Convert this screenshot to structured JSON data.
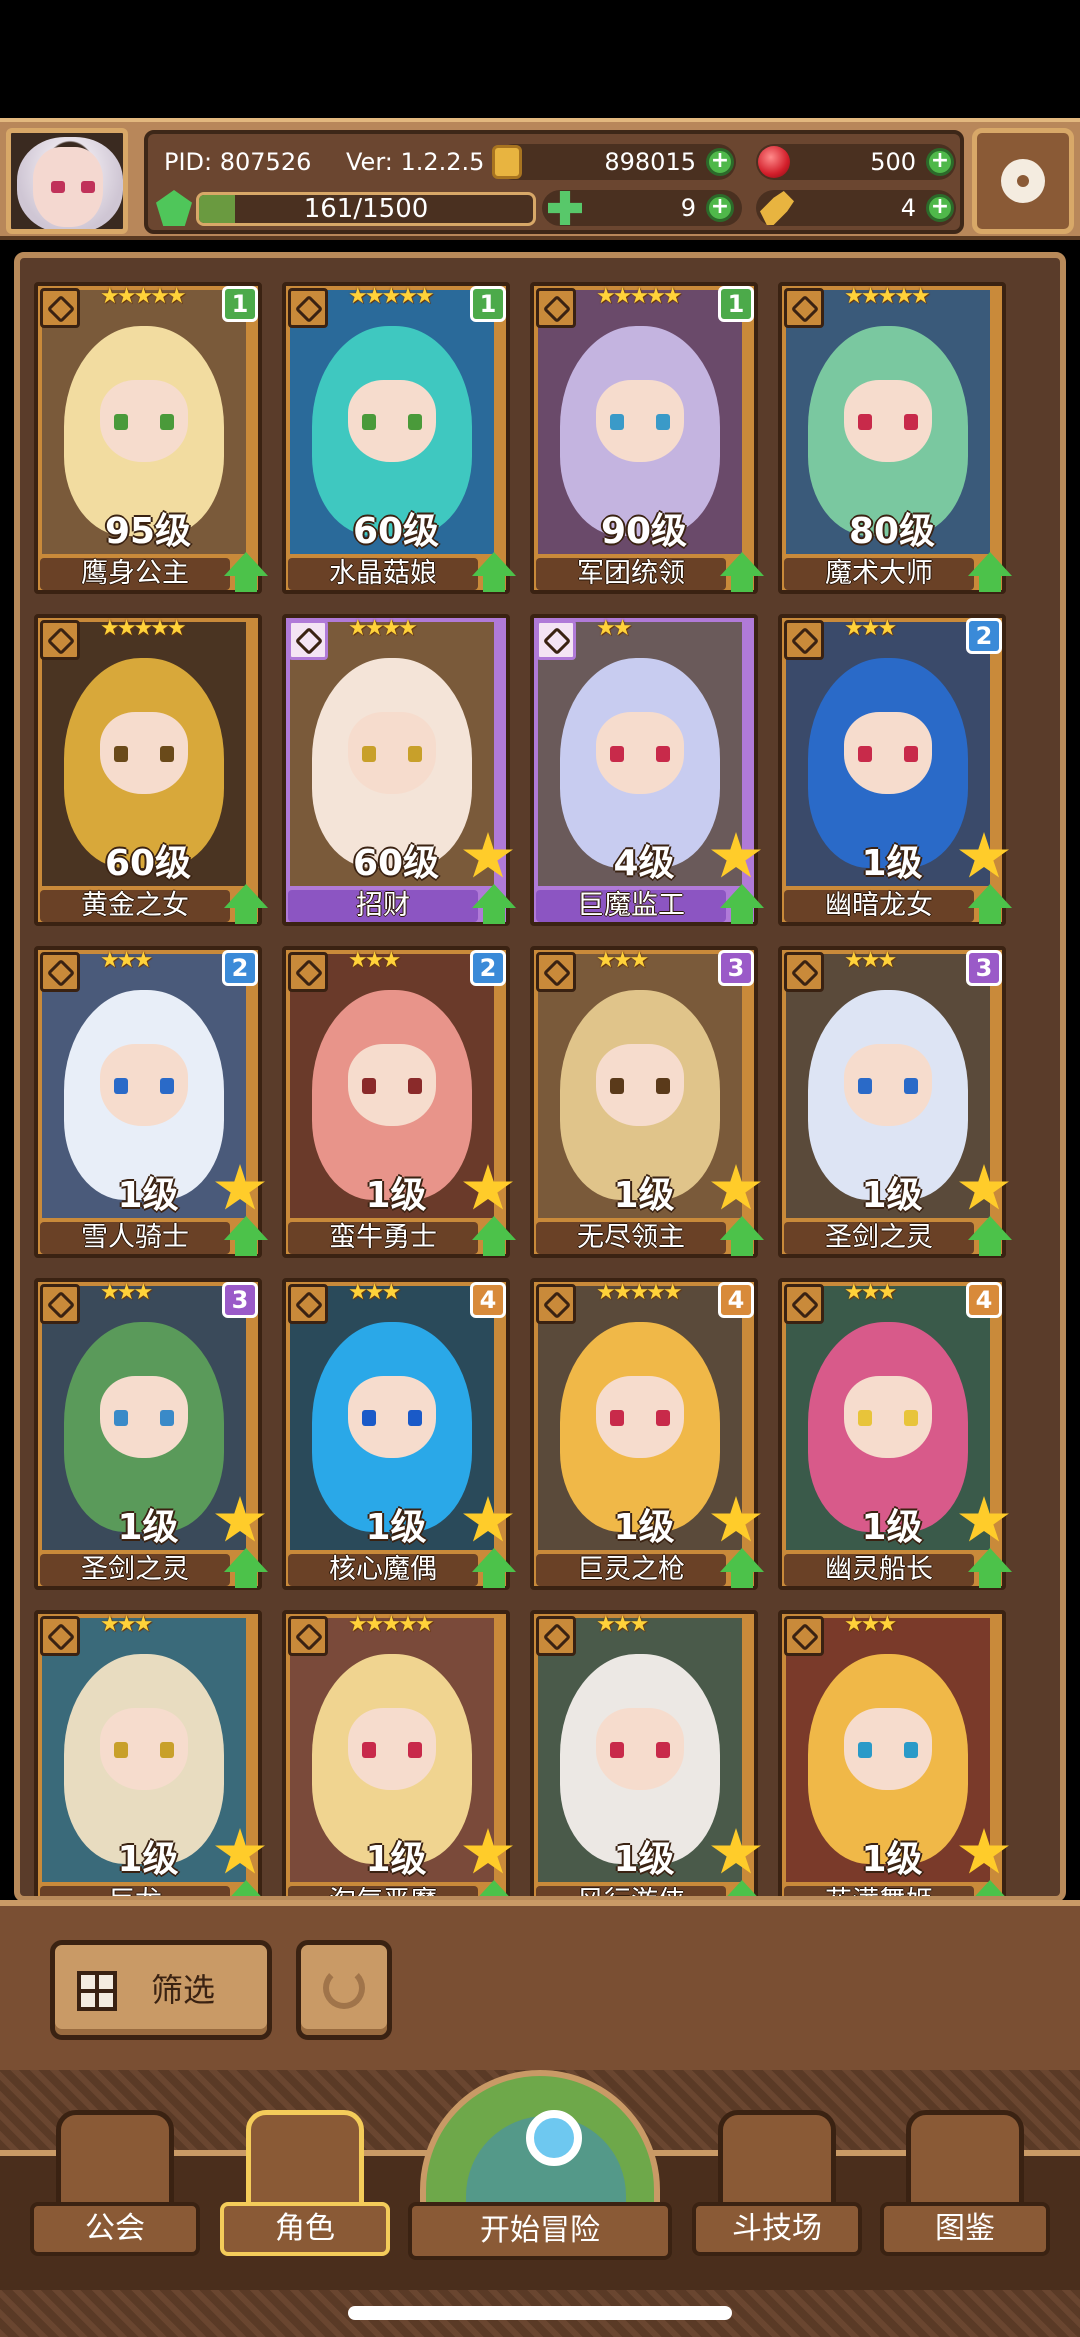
{
  "header": {
    "pid": "PID: 807526",
    "version": "Ver: 1.2.2.5",
    "gold": "898015",
    "ruby": "500",
    "exp": "161/1500",
    "exp_progress": 0.107,
    "clover": "9",
    "key": "4"
  },
  "cards": [
    {
      "name": "鹰身公主",
      "level": "95级",
      "stars": "★★★★★",
      "rank": "1",
      "rank_color": "#4caa4a",
      "frame": "gold",
      "hair": "#f2dca0",
      "bg": "#7a5a3a",
      "eye": "#4a9a3a",
      "big_star": false
    },
    {
      "name": "水晶菇娘",
      "level": "60级",
      "stars": "★★★★★",
      "rank": "1",
      "rank_color": "#4caa4a",
      "frame": "gold",
      "hair": "#3fc8c0",
      "bg": "#2a6a9a",
      "eye": "#4a9a3a",
      "big_star": false
    },
    {
      "name": "军团统领",
      "level": "90级",
      "stars": "★★★★★",
      "rank": "1",
      "rank_color": "#4caa4a",
      "frame": "gold",
      "hair": "#c4b4e0",
      "bg": "#6a4a6a",
      "eye": "#3a9ac8",
      "big_star": false
    },
    {
      "name": "魔术大师",
      "level": "80级",
      "stars": "★★★★★",
      "rank": "",
      "rank_color": "",
      "frame": "gold",
      "hair": "#7ac8a0",
      "bg": "#3a5a7a",
      "eye": "#c82a4a",
      "big_star": false
    },
    {
      "name": "黄金之女",
      "level": "60级",
      "stars": "★★★★★",
      "rank": "",
      "rank_color": "",
      "frame": "gold",
      "hair": "#d8a83a",
      "bg": "#4a3422",
      "eye": "#6a4a1a",
      "big_star": false
    },
    {
      "name": "招财",
      "level": "60级",
      "stars": "★★★★",
      "rank": "",
      "rank_color": "",
      "frame": "purple",
      "hair": "#f4e4d8",
      "bg": "#7a5a3a",
      "eye": "#c8a02a",
      "big_star": true
    },
    {
      "name": "巨魔监工",
      "level": "4级",
      "stars": "★★",
      "rank": "",
      "rank_color": "",
      "frame": "purple",
      "hair": "#c8ccf0",
      "bg": "#6a5a5a",
      "eye": "#c82a4a",
      "big_star": true
    },
    {
      "name": "幽暗龙女",
      "level": "1级",
      "stars": "★★★",
      "rank": "2",
      "rank_color": "#3a8ad8",
      "frame": "gold",
      "hair": "#2a6ac8",
      "bg": "#3a4a6a",
      "eye": "#c82a4a",
      "big_star": true
    },
    {
      "name": "雪人骑士",
      "level": "1级",
      "stars": "★★★",
      "rank": "2",
      "rank_color": "#3a8ad8",
      "frame": "gold",
      "hair": "#e8eef8",
      "bg": "#4a5a7a",
      "eye": "#2a6ac8",
      "big_star": true
    },
    {
      "name": "蛮牛勇士",
      "level": "1级",
      "stars": "★★★",
      "rank": "2",
      "rank_color": "#3a8ad8",
      "frame": "gold",
      "hair": "#e8948a",
      "bg": "#6a3a2a",
      "eye": "#8a2a2a",
      "big_star": true
    },
    {
      "name": "无尽领主",
      "level": "1级",
      "stars": "★★★",
      "rank": "3",
      "rank_color": "#9a5ac8",
      "frame": "gold",
      "hair": "#e0c48a",
      "bg": "#7a5a3a",
      "eye": "#5a3a1a",
      "big_star": true
    },
    {
      "name": "圣剑之灵",
      "level": "1级",
      "stars": "★★★",
      "rank": "3",
      "rank_color": "#9a5ac8",
      "frame": "gold",
      "hair": "#dde4f4",
      "bg": "#5a4a3a",
      "eye": "#2a6ac8",
      "big_star": true
    },
    {
      "name": "圣剑之灵",
      "level": "1级",
      "stars": "★★★",
      "rank": "3",
      "rank_color": "#9a5ac8",
      "frame": "gold",
      "hair": "#5a9a5a",
      "bg": "#3a4a5a",
      "eye": "#3a8ac8",
      "big_star": true
    },
    {
      "name": "核心魔偶",
      "level": "1级",
      "stars": "★★★",
      "rank": "4",
      "rank_color": "#d88a3a",
      "frame": "gold",
      "hair": "#2aa8e8",
      "bg": "#2a4a5a",
      "eye": "#1a5ac8",
      "big_star": true
    },
    {
      "name": "巨灵之枪",
      "level": "1级",
      "stars": "★★★★★",
      "rank": "4",
      "rank_color": "#d88a3a",
      "frame": "gold",
      "hair": "#f0b848",
      "bg": "#5a4a3a",
      "eye": "#c82a4a",
      "big_star": true
    },
    {
      "name": "幽灵船长",
      "level": "1级",
      "stars": "★★★",
      "rank": "4",
      "rank_color": "#d88a3a",
      "frame": "gold",
      "hair": "#d85a8a",
      "bg": "#3a5a4a",
      "eye": "#e8c43a",
      "big_star": true
    },
    {
      "name": "巨龙",
      "level": "1级",
      "stars": "★★★",
      "rank": "",
      "rank_color": "",
      "frame": "gold",
      "hair": "#e8dcc0",
      "bg": "#3a6a7a",
      "eye": "#c8a02a",
      "big_star": true
    },
    {
      "name": "淘气恶魔",
      "level": "1级",
      "stars": "★★★★★",
      "rank": "",
      "rank_color": "",
      "frame": "gold",
      "hair": "#f0d490",
      "bg": "#7a4a3a",
      "eye": "#c82a4a",
      "big_star": true
    },
    {
      "name": "风行游侠",
      "level": "1级",
      "stars": "★★★",
      "rank": "",
      "rank_color": "",
      "frame": "gold",
      "hair": "#ece8e4",
      "bg": "#4a5a4a",
      "eye": "#c82a4a",
      "big_star": true
    },
    {
      "name": "花满舞姬",
      "level": "1级",
      "stars": "★★★",
      "rank": "",
      "rank_color": "",
      "frame": "gold",
      "hair": "#f0b848",
      "bg": "#7a3a2a",
      "eye": "#2a9ac8",
      "big_star": true
    }
  ],
  "filter": {
    "label": "筛选"
  },
  "nav": {
    "guild": "公会",
    "characters": "角色",
    "adventure": "开始冒险",
    "arena": "斗技场",
    "codex": "图鉴"
  }
}
